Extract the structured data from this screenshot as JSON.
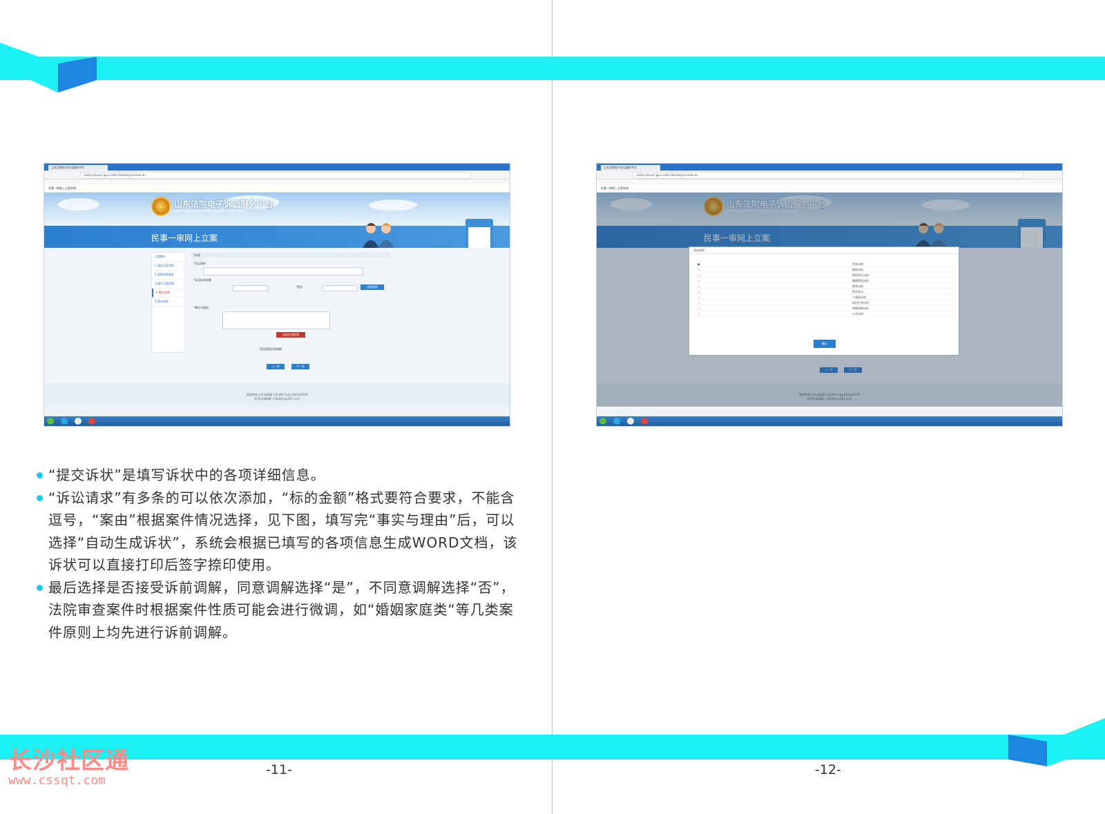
{
  "screenshot_left": {
    "browser_tab": "山东法院电子诉讼服务平台",
    "url": "sdwfy.sdcourt.gov.cn/dzssfw/lawyer/index.do",
    "window_title": "民事一审网上立案申请",
    "site_name": "山东法院电子诉讼服务平台",
    "site_sub": "SHANDONG FAYUAN DIANZI SUSONG FUWU PINGTAI",
    "section_title": "民事一审网上立案",
    "steps": [
      "立案指引",
      "1.阅读立案须知",
      "2.选择法院类型",
      "3.填写立案信息",
      "4.提交诉状",
      "5.提交材料"
    ],
    "form_header": "*诉状",
    "form_labels": {
      "claims": "*诉讼请求",
      "amount": "*诉讼标的金额",
      "cause": "*案由",
      "facts": "*事实与理由",
      "auto_button": "自动生成诉状",
      "select_button": "选择案由",
      "mediation": "是否接受诉前调解",
      "prev_button": "上一步",
      "next_button": "下一步"
    },
    "footer_lines": [
      "版权所有:山东省高级人民法院 Copyright@2018",
      "技术支持邮箱: sdfydzss@163.com"
    ]
  },
  "screenshot_right": {
    "browser_tab": "山东法院电子诉讼服务平台",
    "url": "sdwfy.sdcourt.gov.cn/dzssfw/lawyer/index.do",
    "window_title": "民事一审网上立案申请",
    "site_name": "山东法院电子诉讼服务平台",
    "site_sub": "SHANDONG FAYUAN DIANZI SUSONG FUWU PINGTAI",
    "section_title": "民事一审网上立案",
    "dialog_title": "案由选择",
    "dialog_rows": [
      "合同纠纷",
      "物权纠纷",
      "侵权责任纠纷",
      "婚姻家庭纠纷",
      "继承纠纷",
      "劳动争议",
      "人格权纠纷",
      "知识产权纠纷",
      "海事海商纠纷",
      "公司纠纷"
    ],
    "confirm_button": "确认",
    "prev_button": "上一步",
    "next_button": "下一步",
    "footer_lines": [
      "版权所有:山东省高级人民法院 Copyright@2018",
      "技术支持邮箱: sdfydzss@163.com"
    ]
  },
  "bullets": [
    "“提交诉状”是填写诉状中的各项详细信息。",
    "“诉讼请求”有多条的可以依次添加，“标的金额”格式要符合要求，不能含逗号，“案由”根据案件情况选择，见下图，填写完“事实与理由”后，可以选择“自动生成诉状”，系统会根据已填写的各项信息生成WORD文档，该诉状可以直接打印后签字捺印使用。",
    "最后选择是否接受诉前调解，同意调解选择“是”，不同意调解选择“否”，法院审查案件时根据案件性质可能会进行微调，如“婚姻家庭类“等几类案件原则上均先进行诉前调解。"
  ],
  "page_numbers": {
    "left": "-11-",
    "right": "-12-"
  },
  "watermark": {
    "name": "长沙社区通",
    "url": "www.cssqt.com"
  },
  "colors": {
    "band": "#19f1f4",
    "band_dark": "#1f86e0",
    "bullet_dot": "#19c8e8",
    "watermark": "#ff8a88"
  }
}
